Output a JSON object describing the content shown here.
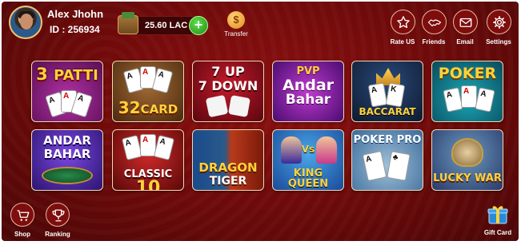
{
  "user": {
    "name": "Alex Jhohn",
    "id": "ID : 256934"
  },
  "wallet": {
    "amount": "25.60 LAC",
    "add_label": "+"
  },
  "transfer": {
    "label": "Transfer"
  },
  "top_buttons": [
    {
      "label": "Rate US",
      "icon": "star-icon"
    },
    {
      "label": "Friends",
      "icon": "handshake-icon"
    },
    {
      "label": "Email",
      "icon": "mail-icon"
    },
    {
      "label": "Settings",
      "icon": "gear-icon"
    }
  ],
  "games": [
    {
      "lines": [
        "3",
        "PATTI"
      ]
    },
    {
      "lines": [
        "32",
        "CARD"
      ]
    },
    {
      "lines": [
        "7 UP",
        "7 DOWN"
      ]
    },
    {
      "lines": [
        "PVP",
        "Andar",
        "Bahar"
      ]
    },
    {
      "lines": [
        "BACCARAT"
      ]
    },
    {
      "lines": [
        "POKER"
      ]
    },
    {
      "lines": [
        "ANDAR",
        "BAHAR"
      ]
    },
    {
      "lines": [
        "CLASSIC",
        "10"
      ]
    },
    {
      "lines": [
        "DRAGON",
        "TIGER"
      ]
    },
    {
      "lines": [
        "Vs",
        "KING QUEEN"
      ]
    },
    {
      "lines": [
        "POKER PRO"
      ]
    },
    {
      "lines": [
        "LUCKY WAR"
      ]
    }
  ],
  "bottom_buttons": [
    {
      "label": "Shop",
      "icon": "cart-icon"
    },
    {
      "label": "Ranking",
      "icon": "trophy-icon"
    },
    {
      "label": "Gift Card",
      "icon": "gift-icon"
    }
  ],
  "colors": {
    "background": "#7a0c0c",
    "accent_gold": "#f3c26b",
    "add_green": "#2fb522"
  }
}
